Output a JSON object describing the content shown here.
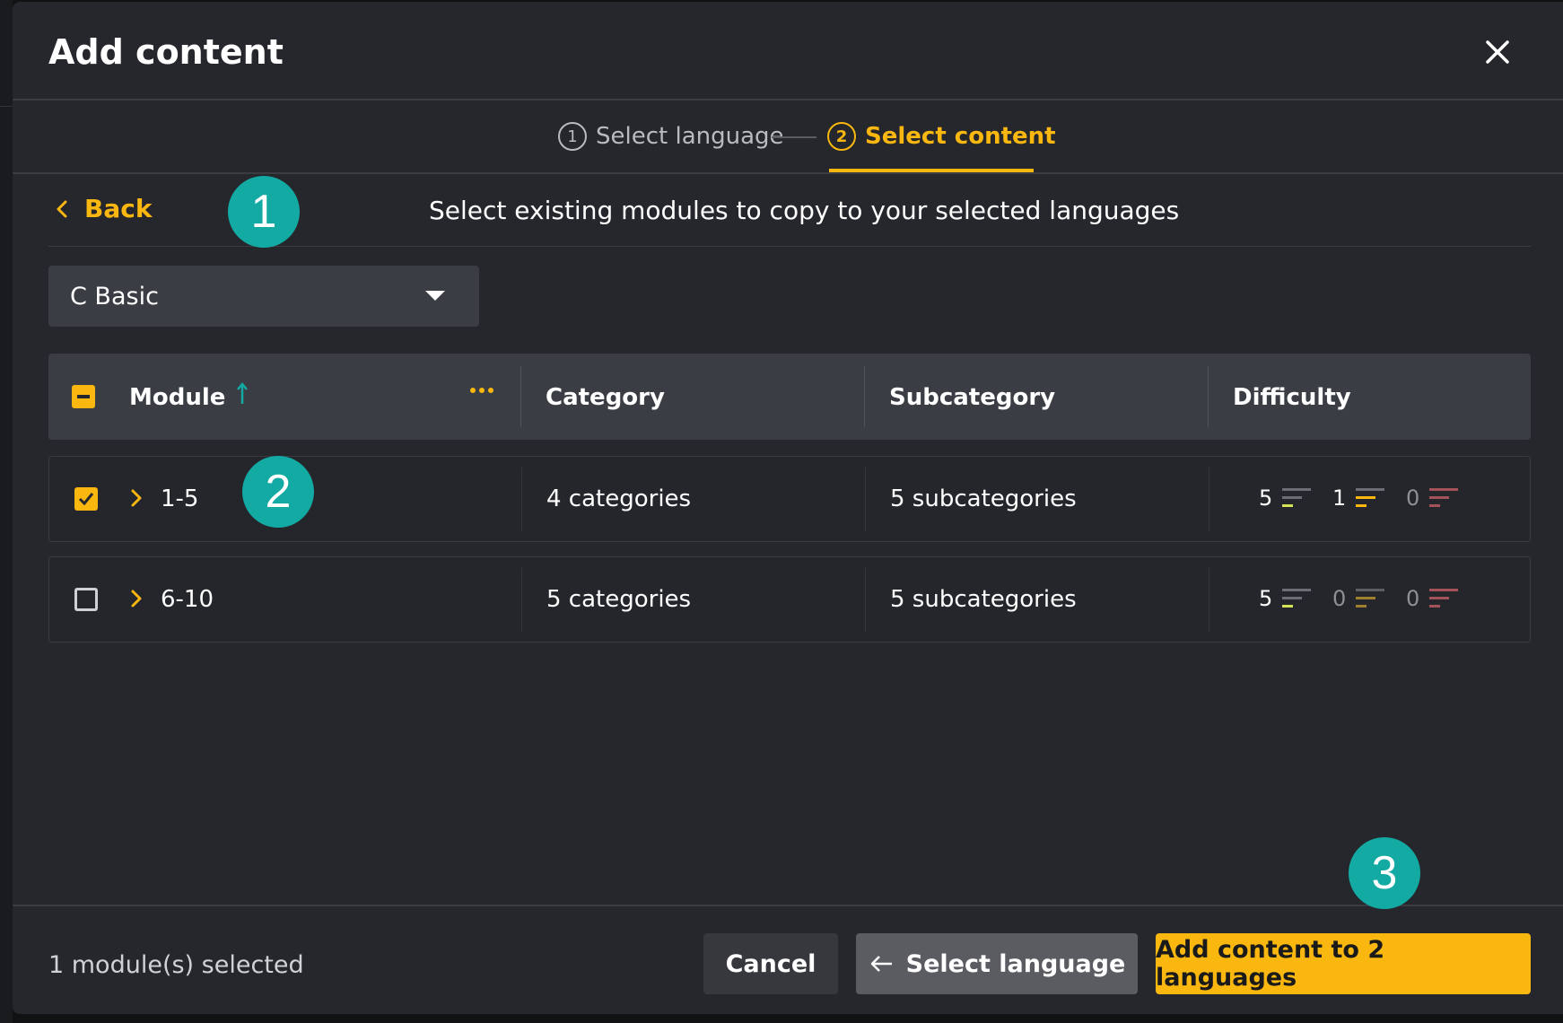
{
  "modal": {
    "title": "Add content"
  },
  "stepper": {
    "steps": [
      {
        "number": "1",
        "label": "Select language",
        "state": "done"
      },
      {
        "number": "2",
        "label": "Select content",
        "state": "active"
      }
    ]
  },
  "nav": {
    "back_label": "Back",
    "instruction": "Select existing modules to copy to your selected languages"
  },
  "course_select": {
    "value": "C Basic"
  },
  "table": {
    "headers": {
      "module": "Module",
      "category": "Category",
      "subcategory": "Subcategory",
      "difficulty": "Difficulty"
    },
    "rows": [
      {
        "checked": true,
        "module": "1-5",
        "category": "4 categories",
        "subcategory": "5 subcategories",
        "difficulty": {
          "easy": "5",
          "medium": "1",
          "hard": "0"
        }
      },
      {
        "checked": false,
        "module": "6-10",
        "category": "5 categories",
        "subcategory": "5 subcategories",
        "difficulty": {
          "easy": "5",
          "medium": "0",
          "hard": "0"
        }
      }
    ]
  },
  "footer": {
    "selection_text": "1 module(s) selected",
    "cancel_label": "Cancel",
    "prev_label": "Select language",
    "submit_label": "Add content to 2 languages"
  },
  "annotations": [
    "1",
    "2",
    "3"
  ],
  "colors": {
    "accent": "#f9b70f",
    "badge": "#13aaa3",
    "easy": "#d4e157",
    "medium": "#f9b70f",
    "hard": "#e57373"
  }
}
